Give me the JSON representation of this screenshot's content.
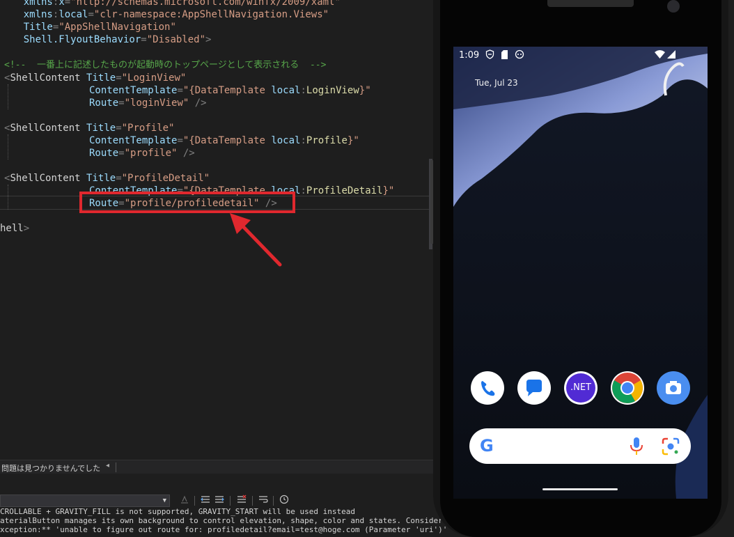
{
  "editor": {
    "lines": [
      {
        "indent": "    ",
        "attr_prefix": "xmlns",
        "colon": ":",
        "attr": "x",
        "eq": "=",
        "value": "\"http://schemas.microsoft.com/winfx/2009/xaml\""
      },
      {
        "indent": "    ",
        "attr_prefix": "xmlns",
        "colon": ":",
        "attr": "local",
        "eq": "=",
        "value": "\"clr-namespace:AppShellNavigation.Views\""
      },
      {
        "indent": "    ",
        "attr": "Title",
        "eq": "=",
        "value": "\"AppShellNavigation\""
      },
      {
        "indent": "    ",
        "attr": "Shell.FlyoutBehavior",
        "eq": "=",
        "value": "\"Disabled\"",
        "close": ">"
      }
    ],
    "comment": "<!--  一番上に記述したものが起動時のトップページとして表示される  -->",
    "shell_contents": [
      {
        "tag_open": "<",
        "tag": "ShellContent",
        "title_attr": "Title",
        "title_value": "\"LoginView\"",
        "template_attr": "ContentTemplate",
        "template_open": "\"{",
        "template_kw": "DataTemplate",
        "template_ns": "local",
        "template_type": "LoginView",
        "template_close": "}\"",
        "route_attr": "Route",
        "route_value": "\"loginView\"",
        "end": " />"
      },
      {
        "tag_open": "<",
        "tag": "ShellContent",
        "title_attr": "Title",
        "title_value": "\"Profile\"",
        "template_attr": "ContentTemplate",
        "template_open": "\"{",
        "template_kw": "DataTemplate",
        "template_ns": "local",
        "template_type": "Profile",
        "template_close": "}\"",
        "route_attr": "Route",
        "route_value": "\"profile\"",
        "end": " />"
      },
      {
        "tag_open": "<",
        "tag": "ShellContent",
        "title_attr": "Title",
        "title_value": "\"ProfileDetail\"",
        "template_attr": "ContentTemplate",
        "template_open": "\"{",
        "template_kw": "DataTemplate",
        "template_ns": "local",
        "template_type": "ProfileDetail",
        "template_close": "}\"",
        "route_attr": "Route",
        "route_value": "\"profile/profiledetail\"",
        "end": " />"
      }
    ],
    "closing_tag_fragment": "hell",
    "closing_tag_end": ">"
  },
  "status_bar": {
    "message": "問題は見つかりませんでした",
    "scroll_left_glyph": "◂"
  },
  "output": {
    "lines": [
      "CROLLABLE + GRAVITY_FILL is not supported, GRAVITY_START will be used instead",
      "aterialButton manages its own background to control elevation, shape, color and states. Consider using ba",
      "xception:** 'unable to figure out route for: profiledetail?email=test@hoge.com (Parameter 'uri')'"
    ],
    "toolbar_icons": [
      "find-icon",
      "align-left-icon",
      "align-right-icon",
      "clear-all-icon",
      "word-wrap-icon",
      "clock-icon"
    ]
  },
  "phone": {
    "status_time": "1:09",
    "date": "Tue, Jul 23",
    "apps": [
      "phone-app",
      "messages-app",
      "dotnet-app",
      "chrome-app",
      "camera-app"
    ],
    "dotnet_label": ".NET",
    "google_letter": "G"
  },
  "colors": {
    "highlight": "#e0282e",
    "comment": "#57a64a",
    "attribute": "#9cdcfe",
    "string": "#d69d85"
  }
}
